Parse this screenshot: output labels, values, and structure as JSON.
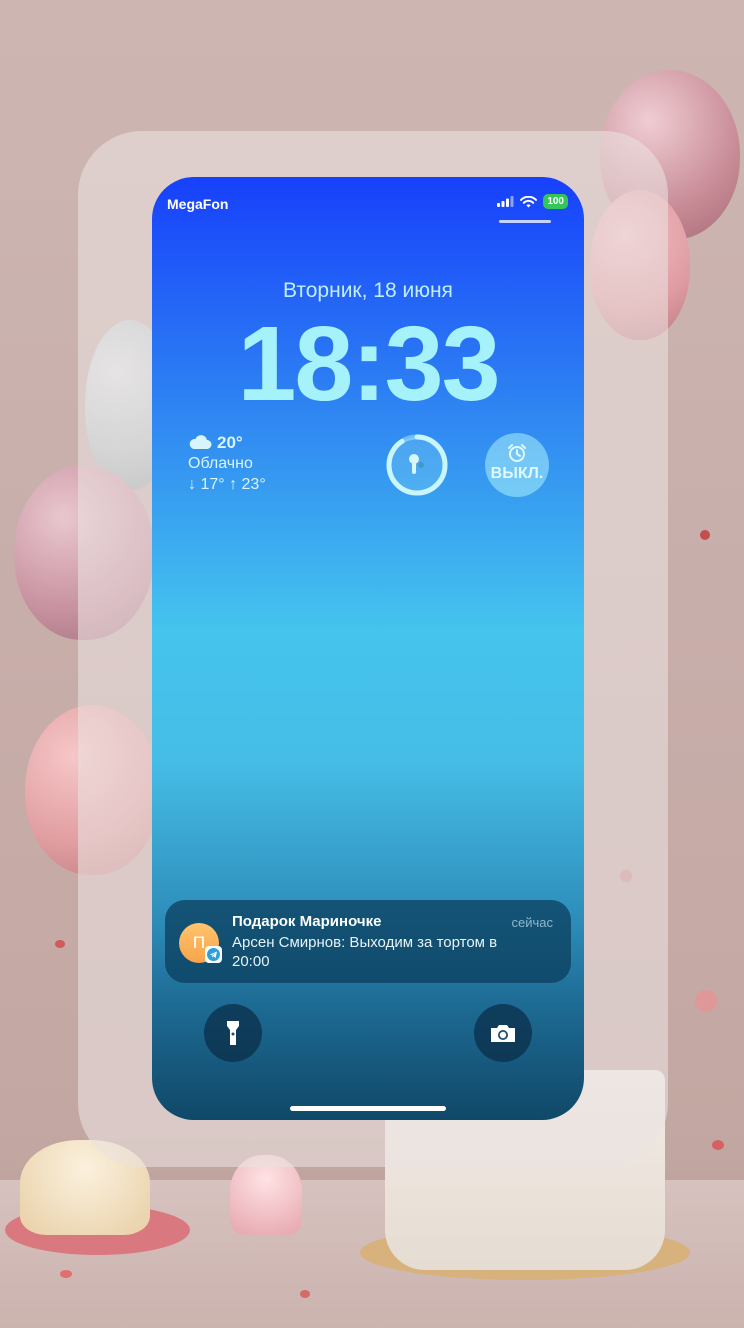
{
  "status_bar": {
    "carrier": "MegaFon",
    "battery": "100",
    "battery_color": "#33c759"
  },
  "lock_screen": {
    "date": "Вторник, 18 июня",
    "time": "18:33"
  },
  "weather_widget": {
    "icon": "cloud-icon",
    "temperature": "20°",
    "condition": "Облачно",
    "low_high": "↓ 17° ↑ 23°"
  },
  "airpods_widget": {
    "icon": "airpods-icon"
  },
  "alarm_widget": {
    "icon": "alarm-clock-icon",
    "label": "ВЫКЛ."
  },
  "notification": {
    "app_icon": "telegram-icon",
    "avatar_initial": "П",
    "title": "Подарок Мариночке",
    "time": "сейчас",
    "body": "Арсен Смирнов: Выходим за тортом в 20:00"
  },
  "quick_actions": {
    "left_icon": "flashlight-icon",
    "right_icon": "camera-icon"
  },
  "colors": {
    "gradient_top": "#1740fb",
    "gradient_mid": "#45c4ee",
    "gradient_bottom": "#104868",
    "time_color": "#a6f2fb"
  }
}
